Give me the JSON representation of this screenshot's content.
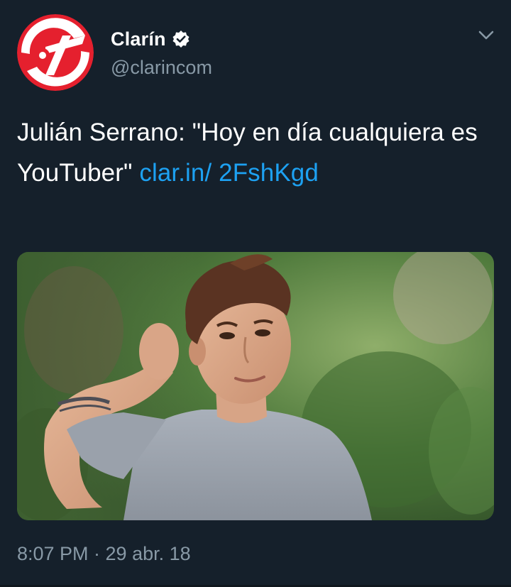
{
  "tweet": {
    "author": {
      "display_name": "Clarín",
      "handle": "@clarincom",
      "verified": true,
      "avatar_icon": "clarin-logo-icon",
      "avatar_color": "#e5202e"
    },
    "text_main": "Julián Serrano: \"Hoy en día cualquiera es YouTuber\" ",
    "link_text": "clar.in/ 2FshKgd",
    "timestamp": "8:07 PM · 29 abr. 18",
    "menu_icon": "chevron-down-icon",
    "media": {
      "type": "photo"
    }
  },
  "colors": {
    "background": "#15202b",
    "text_primary": "#ffffff",
    "text_secondary": "#8899a6",
    "link": "#1da1f2",
    "brand_red": "#e5202e"
  }
}
